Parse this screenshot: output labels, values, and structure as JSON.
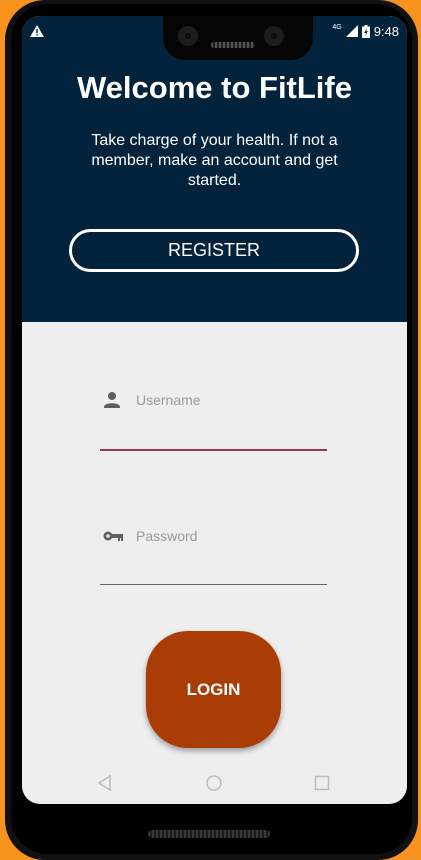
{
  "status_bar": {
    "network": "4G",
    "time": "9:48"
  },
  "hero": {
    "title": "Welcome to FitLife",
    "subtitle": "Take charge of your health. If not a member, make an account and get started.",
    "register_label": "REGISTER"
  },
  "form": {
    "username_placeholder": "Username",
    "password_placeholder": "Password",
    "login_label": "LOGIN"
  },
  "colors": {
    "hero_bg": "#03223c",
    "login_bg": "#aa3d05",
    "field_focus": "#a03550",
    "page_bg": "#eeeeee"
  },
  "icons": {
    "username": "person-icon",
    "password": "key-icon",
    "nav": [
      "back-icon",
      "home-icon",
      "recents-icon"
    ]
  }
}
